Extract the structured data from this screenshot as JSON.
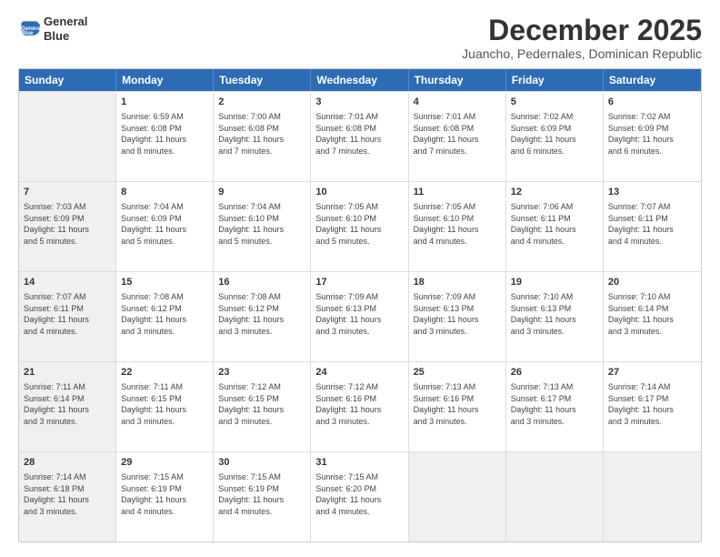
{
  "logo": {
    "line1": "General",
    "line2": "Blue"
  },
  "title": "December 2025",
  "subtitle": "Juancho, Pedernales, Dominican Republic",
  "header_days": [
    "Sunday",
    "Monday",
    "Tuesday",
    "Wednesday",
    "Thursday",
    "Friday",
    "Saturday"
  ],
  "weeks": [
    [
      {
        "day": "",
        "info": "",
        "shaded": true
      },
      {
        "day": "1",
        "info": "Sunrise: 6:59 AM\nSunset: 6:08 PM\nDaylight: 11 hours\nand 8 minutes.",
        "shaded": false
      },
      {
        "day": "2",
        "info": "Sunrise: 7:00 AM\nSunset: 6:08 PM\nDaylight: 11 hours\nand 7 minutes.",
        "shaded": false
      },
      {
        "day": "3",
        "info": "Sunrise: 7:01 AM\nSunset: 6:08 PM\nDaylight: 11 hours\nand 7 minutes.",
        "shaded": false
      },
      {
        "day": "4",
        "info": "Sunrise: 7:01 AM\nSunset: 6:08 PM\nDaylight: 11 hours\nand 7 minutes.",
        "shaded": false
      },
      {
        "day": "5",
        "info": "Sunrise: 7:02 AM\nSunset: 6:09 PM\nDaylight: 11 hours\nand 6 minutes.",
        "shaded": false
      },
      {
        "day": "6",
        "info": "Sunrise: 7:02 AM\nSunset: 6:09 PM\nDaylight: 11 hours\nand 6 minutes.",
        "shaded": false
      }
    ],
    [
      {
        "day": "7",
        "info": "Sunrise: 7:03 AM\nSunset: 6:09 PM\nDaylight: 11 hours\nand 5 minutes.",
        "shaded": true
      },
      {
        "day": "8",
        "info": "Sunrise: 7:04 AM\nSunset: 6:09 PM\nDaylight: 11 hours\nand 5 minutes.",
        "shaded": false
      },
      {
        "day": "9",
        "info": "Sunrise: 7:04 AM\nSunset: 6:10 PM\nDaylight: 11 hours\nand 5 minutes.",
        "shaded": false
      },
      {
        "day": "10",
        "info": "Sunrise: 7:05 AM\nSunset: 6:10 PM\nDaylight: 11 hours\nand 5 minutes.",
        "shaded": false
      },
      {
        "day": "11",
        "info": "Sunrise: 7:05 AM\nSunset: 6:10 PM\nDaylight: 11 hours\nand 4 minutes.",
        "shaded": false
      },
      {
        "day": "12",
        "info": "Sunrise: 7:06 AM\nSunset: 6:11 PM\nDaylight: 11 hours\nand 4 minutes.",
        "shaded": false
      },
      {
        "day": "13",
        "info": "Sunrise: 7:07 AM\nSunset: 6:11 PM\nDaylight: 11 hours\nand 4 minutes.",
        "shaded": false
      }
    ],
    [
      {
        "day": "14",
        "info": "Sunrise: 7:07 AM\nSunset: 6:11 PM\nDaylight: 11 hours\nand 4 minutes.",
        "shaded": true
      },
      {
        "day": "15",
        "info": "Sunrise: 7:08 AM\nSunset: 6:12 PM\nDaylight: 11 hours\nand 3 minutes.",
        "shaded": false
      },
      {
        "day": "16",
        "info": "Sunrise: 7:08 AM\nSunset: 6:12 PM\nDaylight: 11 hours\nand 3 minutes.",
        "shaded": false
      },
      {
        "day": "17",
        "info": "Sunrise: 7:09 AM\nSunset: 6:13 PM\nDaylight: 11 hours\nand 3 minutes.",
        "shaded": false
      },
      {
        "day": "18",
        "info": "Sunrise: 7:09 AM\nSunset: 6:13 PM\nDaylight: 11 hours\nand 3 minutes.",
        "shaded": false
      },
      {
        "day": "19",
        "info": "Sunrise: 7:10 AM\nSunset: 6:13 PM\nDaylight: 11 hours\nand 3 minutes.",
        "shaded": false
      },
      {
        "day": "20",
        "info": "Sunrise: 7:10 AM\nSunset: 6:14 PM\nDaylight: 11 hours\nand 3 minutes.",
        "shaded": false
      }
    ],
    [
      {
        "day": "21",
        "info": "Sunrise: 7:11 AM\nSunset: 6:14 PM\nDaylight: 11 hours\nand 3 minutes.",
        "shaded": true
      },
      {
        "day": "22",
        "info": "Sunrise: 7:11 AM\nSunset: 6:15 PM\nDaylight: 11 hours\nand 3 minutes.",
        "shaded": false
      },
      {
        "day": "23",
        "info": "Sunrise: 7:12 AM\nSunset: 6:15 PM\nDaylight: 11 hours\nand 3 minutes.",
        "shaded": false
      },
      {
        "day": "24",
        "info": "Sunrise: 7:12 AM\nSunset: 6:16 PM\nDaylight: 11 hours\nand 3 minutes.",
        "shaded": false
      },
      {
        "day": "25",
        "info": "Sunrise: 7:13 AM\nSunset: 6:16 PM\nDaylight: 11 hours\nand 3 minutes.",
        "shaded": false
      },
      {
        "day": "26",
        "info": "Sunrise: 7:13 AM\nSunset: 6:17 PM\nDaylight: 11 hours\nand 3 minutes.",
        "shaded": false
      },
      {
        "day": "27",
        "info": "Sunrise: 7:14 AM\nSunset: 6:17 PM\nDaylight: 11 hours\nand 3 minutes.",
        "shaded": false
      }
    ],
    [
      {
        "day": "28",
        "info": "Sunrise: 7:14 AM\nSunset: 6:18 PM\nDaylight: 11 hours\nand 3 minutes.",
        "shaded": true
      },
      {
        "day": "29",
        "info": "Sunrise: 7:15 AM\nSunset: 6:19 PM\nDaylight: 11 hours\nand 4 minutes.",
        "shaded": false
      },
      {
        "day": "30",
        "info": "Sunrise: 7:15 AM\nSunset: 6:19 PM\nDaylight: 11 hours\nand 4 minutes.",
        "shaded": false
      },
      {
        "day": "31",
        "info": "Sunrise: 7:15 AM\nSunset: 6:20 PM\nDaylight: 11 hours\nand 4 minutes.",
        "shaded": false
      },
      {
        "day": "",
        "info": "",
        "shaded": true
      },
      {
        "day": "",
        "info": "",
        "shaded": true
      },
      {
        "day": "",
        "info": "",
        "shaded": true
      }
    ]
  ]
}
